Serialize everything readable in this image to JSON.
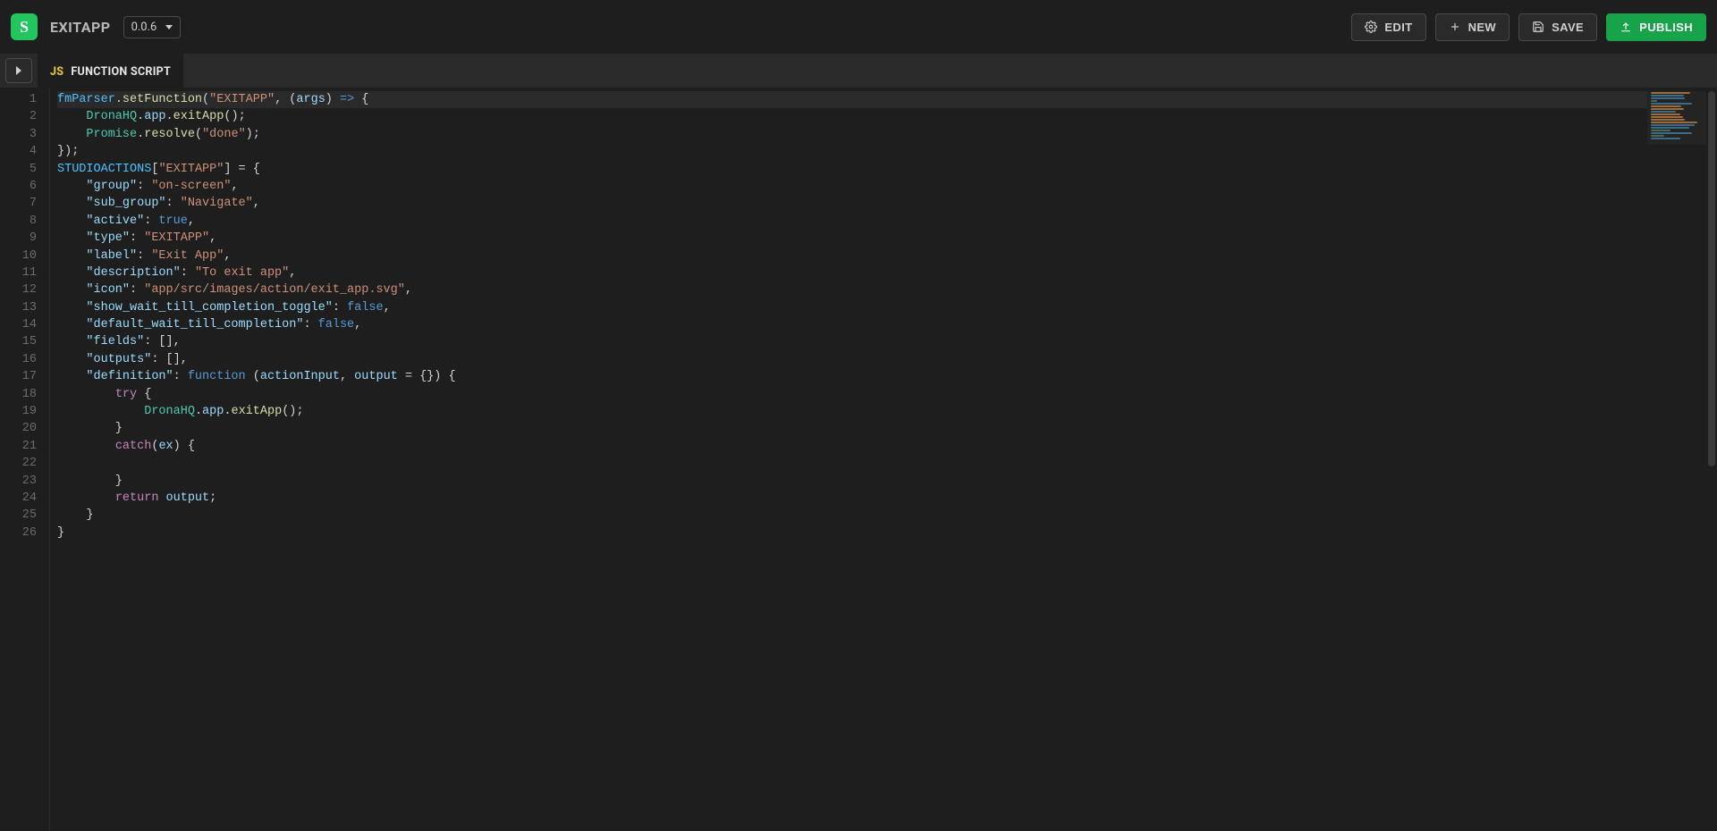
{
  "logo_letter": "S",
  "app_title": "EXITAPP",
  "version": "0.0.6",
  "actions": {
    "edit": "EDIT",
    "new": "NEW",
    "save": "SAVE",
    "publish": "PUBLISH"
  },
  "tab": {
    "badge": "JS",
    "label": "FUNCTION SCRIPT"
  },
  "line_count": 26,
  "code_lines": [
    [
      {
        "t": "fmParser",
        "c": "tok-obj"
      },
      {
        "t": ".",
        "c": "tok-pun"
      },
      {
        "t": "setFunction",
        "c": "tok-call"
      },
      {
        "t": "(",
        "c": "tok-pun"
      },
      {
        "t": "\"EXITAPP\"",
        "c": "tok-str"
      },
      {
        "t": ", (",
        "c": "tok-pun"
      },
      {
        "t": "args",
        "c": "tok-var"
      },
      {
        "t": ") ",
        "c": "tok-pun"
      },
      {
        "t": "=>",
        "c": "tok-kw"
      },
      {
        "t": " {",
        "c": "tok-pun"
      }
    ],
    [
      {
        "t": "    ",
        "c": "tok-pun"
      },
      {
        "t": "DronaHQ",
        "c": "tok-global"
      },
      {
        "t": ".",
        "c": "tok-pun"
      },
      {
        "t": "app",
        "c": "tok-var"
      },
      {
        "t": ".",
        "c": "tok-pun"
      },
      {
        "t": "exitApp",
        "c": "tok-call"
      },
      {
        "t": "();",
        "c": "tok-pun"
      }
    ],
    [
      {
        "t": "    ",
        "c": "tok-pun"
      },
      {
        "t": "Promise",
        "c": "tok-global"
      },
      {
        "t": ".",
        "c": "tok-pun"
      },
      {
        "t": "resolve",
        "c": "tok-call"
      },
      {
        "t": "(",
        "c": "tok-pun"
      },
      {
        "t": "\"done\"",
        "c": "tok-str"
      },
      {
        "t": ");",
        "c": "tok-pun"
      }
    ],
    [
      {
        "t": "});",
        "c": "tok-pun"
      }
    ],
    [
      {
        "t": "STUDIOACTIONS",
        "c": "tok-obj"
      },
      {
        "t": "[",
        "c": "tok-pun"
      },
      {
        "t": "\"EXITAPP\"",
        "c": "tok-str"
      },
      {
        "t": "] = {",
        "c": "tok-pun"
      }
    ],
    [
      {
        "t": "    ",
        "c": "tok-pun"
      },
      {
        "t": "\"group\"",
        "c": "tok-var"
      },
      {
        "t": ": ",
        "c": "tok-pun"
      },
      {
        "t": "\"on-screen\"",
        "c": "tok-str"
      },
      {
        "t": ",",
        "c": "tok-pun"
      }
    ],
    [
      {
        "t": "    ",
        "c": "tok-pun"
      },
      {
        "t": "\"sub_group\"",
        "c": "tok-var"
      },
      {
        "t": ": ",
        "c": "tok-pun"
      },
      {
        "t": "\"Navigate\"",
        "c": "tok-str"
      },
      {
        "t": ",",
        "c": "tok-pun"
      }
    ],
    [
      {
        "t": "    ",
        "c": "tok-pun"
      },
      {
        "t": "\"active\"",
        "c": "tok-var"
      },
      {
        "t": ": ",
        "c": "tok-pun"
      },
      {
        "t": "true",
        "c": "tok-kw"
      },
      {
        "t": ",",
        "c": "tok-pun"
      }
    ],
    [
      {
        "t": "    ",
        "c": "tok-pun"
      },
      {
        "t": "\"type\"",
        "c": "tok-var"
      },
      {
        "t": ": ",
        "c": "tok-pun"
      },
      {
        "t": "\"EXITAPP\"",
        "c": "tok-str"
      },
      {
        "t": ",",
        "c": "tok-pun"
      }
    ],
    [
      {
        "t": "    ",
        "c": "tok-pun"
      },
      {
        "t": "\"label\"",
        "c": "tok-var"
      },
      {
        "t": ": ",
        "c": "tok-pun"
      },
      {
        "t": "\"Exit App\"",
        "c": "tok-str"
      },
      {
        "t": ",",
        "c": "tok-pun"
      }
    ],
    [
      {
        "t": "    ",
        "c": "tok-pun"
      },
      {
        "t": "\"description\"",
        "c": "tok-var"
      },
      {
        "t": ": ",
        "c": "tok-pun"
      },
      {
        "t": "\"To exit app\"",
        "c": "tok-str"
      },
      {
        "t": ",",
        "c": "tok-pun"
      }
    ],
    [
      {
        "t": "    ",
        "c": "tok-pun"
      },
      {
        "t": "\"icon\"",
        "c": "tok-var"
      },
      {
        "t": ": ",
        "c": "tok-pun"
      },
      {
        "t": "\"app/src/images/action/exit_app.svg\"",
        "c": "tok-str"
      },
      {
        "t": ",",
        "c": "tok-pun"
      }
    ],
    [
      {
        "t": "    ",
        "c": "tok-pun"
      },
      {
        "t": "\"show_wait_till_completion_toggle\"",
        "c": "tok-var"
      },
      {
        "t": ": ",
        "c": "tok-pun"
      },
      {
        "t": "false",
        "c": "tok-kw"
      },
      {
        "t": ",",
        "c": "tok-pun"
      }
    ],
    [
      {
        "t": "    ",
        "c": "tok-pun"
      },
      {
        "t": "\"default_wait_till_completion\"",
        "c": "tok-var"
      },
      {
        "t": ": ",
        "c": "tok-pun"
      },
      {
        "t": "false",
        "c": "tok-kw"
      },
      {
        "t": ",",
        "c": "tok-pun"
      }
    ],
    [
      {
        "t": "    ",
        "c": "tok-pun"
      },
      {
        "t": "\"fields\"",
        "c": "tok-var"
      },
      {
        "t": ": [],",
        "c": "tok-pun"
      }
    ],
    [
      {
        "t": "    ",
        "c": "tok-pun"
      },
      {
        "t": "\"outputs\"",
        "c": "tok-var"
      },
      {
        "t": ": [],",
        "c": "tok-pun"
      }
    ],
    [
      {
        "t": "    ",
        "c": "tok-pun"
      },
      {
        "t": "\"definition\"",
        "c": "tok-var"
      },
      {
        "t": ": ",
        "c": "tok-pun"
      },
      {
        "t": "function",
        "c": "tok-kw"
      },
      {
        "t": " (",
        "c": "tok-pun"
      },
      {
        "t": "actionInput",
        "c": "tok-var"
      },
      {
        "t": ", ",
        "c": "tok-pun"
      },
      {
        "t": "output",
        "c": "tok-var"
      },
      {
        "t": " = {}) {",
        "c": "tok-pun"
      }
    ],
    [
      {
        "t": "        ",
        "c": "tok-pun"
      },
      {
        "t": "try",
        "c": "tok-kw2"
      },
      {
        "t": " {",
        "c": "tok-pun"
      }
    ],
    [
      {
        "t": "            ",
        "c": "tok-pun"
      },
      {
        "t": "DronaHQ",
        "c": "tok-global"
      },
      {
        "t": ".",
        "c": "tok-pun"
      },
      {
        "t": "app",
        "c": "tok-var"
      },
      {
        "t": ".",
        "c": "tok-pun"
      },
      {
        "t": "exitApp",
        "c": "tok-call"
      },
      {
        "t": "();",
        "c": "tok-pun"
      }
    ],
    [
      {
        "t": "        }",
        "c": "tok-pun"
      }
    ],
    [
      {
        "t": "        ",
        "c": "tok-pun"
      },
      {
        "t": "catch",
        "c": "tok-kw2"
      },
      {
        "t": "(",
        "c": "tok-pun"
      },
      {
        "t": "ex",
        "c": "tok-var"
      },
      {
        "t": ") {",
        "c": "tok-pun"
      }
    ],
    [
      {
        "t": "",
        "c": "tok-pun"
      }
    ],
    [
      {
        "t": "        }",
        "c": "tok-pun"
      }
    ],
    [
      {
        "t": "        ",
        "c": "tok-pun"
      },
      {
        "t": "return",
        "c": "tok-kw2"
      },
      {
        "t": " ",
        "c": "tok-pun"
      },
      {
        "t": "output",
        "c": "tok-var"
      },
      {
        "t": ";",
        "c": "tok-pun"
      }
    ],
    [
      {
        "t": "    }",
        "c": "tok-pun"
      }
    ],
    [
      {
        "t": "}",
        "c": "tok-pun"
      }
    ]
  ]
}
